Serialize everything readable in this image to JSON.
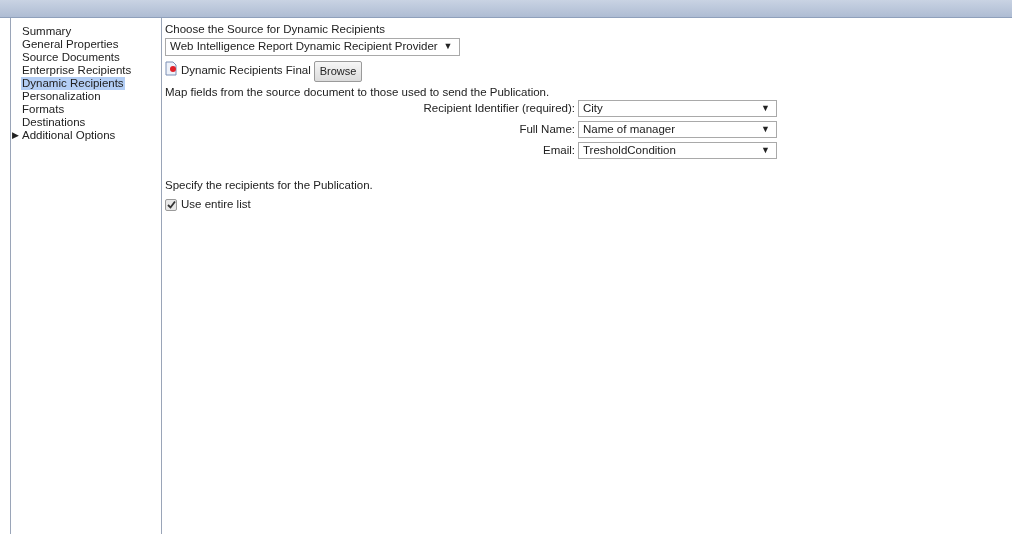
{
  "sidebar": {
    "items": [
      {
        "label": "Summary",
        "selected": false
      },
      {
        "label": "General Properties",
        "selected": false
      },
      {
        "label": "Source Documents",
        "selected": false
      },
      {
        "label": "Enterprise Recipients",
        "selected": false
      },
      {
        "label": "Dynamic Recipients",
        "selected": true
      },
      {
        "label": "Personalization",
        "selected": false
      },
      {
        "label": "Formats",
        "selected": false
      },
      {
        "label": "Destinations",
        "selected": false
      },
      {
        "label": "Additional Options",
        "selected": false,
        "toggle": "▶"
      }
    ]
  },
  "content": {
    "source_heading": "Choose the Source for Dynamic Recipients",
    "source_select": "Web Intelligence Report Dynamic Recipient Provider",
    "document_name": "Dynamic Recipients Final",
    "browse_button": "Browse",
    "map_text": "Map fields from the source document to those used to send the Publication.",
    "mappings": [
      {
        "label": "Recipient Identifier (required):",
        "value": "City"
      },
      {
        "label": "Full Name:",
        "value": "Name of manager"
      },
      {
        "label": "Email:",
        "value": "TresholdCondition"
      }
    ],
    "recipients_text": "Specify the recipients for the Publication.",
    "use_entire_list": {
      "label": "Use entire list",
      "checked": true
    },
    "caret": "▼"
  }
}
